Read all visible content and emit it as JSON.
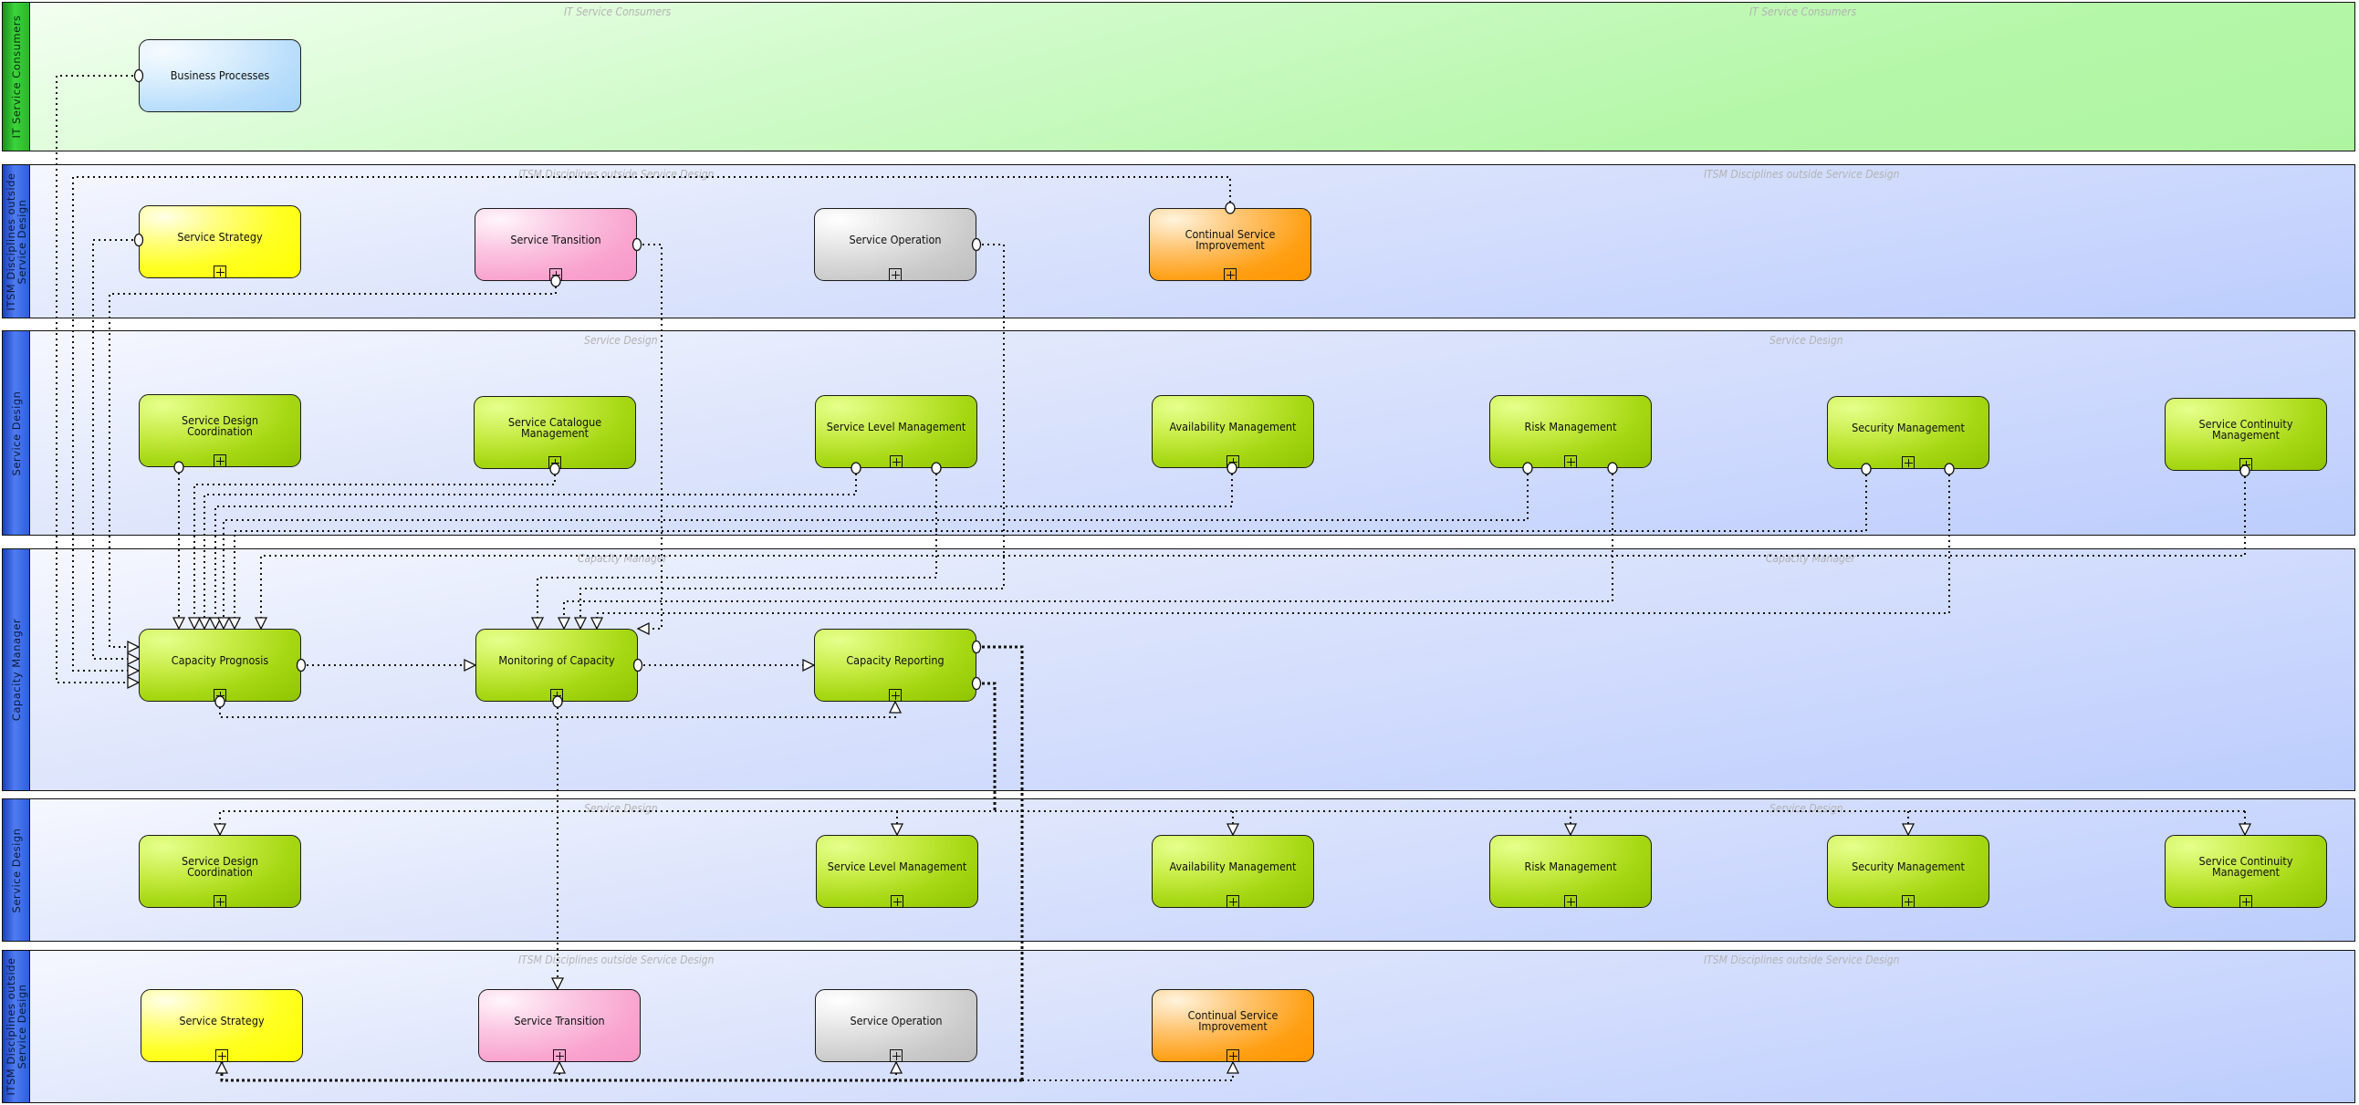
{
  "diagram": {
    "type": "process-map",
    "lanes": [
      {
        "id": "consumers",
        "title": "IT Service Consumers",
        "watermark": "IT Service Consumers",
        "color": "green"
      },
      {
        "id": "itsm-top",
        "title": "ITSM Disciplines outside\nService Design",
        "watermark": "ITSM Disciplines outside Service Design",
        "color": "blue"
      },
      {
        "id": "sd-top",
        "title": "Service Design",
        "watermark": "Service Design",
        "color": "blue"
      },
      {
        "id": "capacity",
        "title": "Capacity Manager",
        "watermark": "Capacity Manager",
        "color": "blue"
      },
      {
        "id": "sd-bottom",
        "title": "Service Design",
        "watermark": "Service Design",
        "color": "blue"
      },
      {
        "id": "itsm-bottom",
        "title": "ITSM Disciplines outside\nService Design",
        "watermark": "ITSM Disciplines outside Service Design",
        "color": "blue"
      }
    ],
    "nodes": {
      "bp": {
        "label": "Business Processes",
        "lane": "consumers",
        "color": "blue",
        "expandable": false
      },
      "ss1": {
        "label": "Service Strategy",
        "lane": "itsm-top",
        "color": "yellow",
        "expandable": true
      },
      "st1": {
        "label": "Service Transition",
        "lane": "itsm-top",
        "color": "pink",
        "expandable": true
      },
      "so1": {
        "label": "Service Operation",
        "lane": "itsm-top",
        "color": "gray",
        "expandable": true
      },
      "csi1": {
        "label": "Continual Service\nImprovement",
        "lane": "itsm-top",
        "color": "orange",
        "expandable": true
      },
      "sdc1": {
        "label": "Service Design\nCoordination",
        "lane": "sd-top",
        "color": "green",
        "expandable": true
      },
      "scm1": {
        "label": "Service Catalogue\nManagement",
        "lane": "sd-top",
        "color": "green",
        "expandable": true
      },
      "slm1": {
        "label": "Service Level Management",
        "lane": "sd-top",
        "color": "green",
        "expandable": true
      },
      "am1": {
        "label": "Availability Management",
        "lane": "sd-top",
        "color": "green",
        "expandable": true
      },
      "rm1": {
        "label": "Risk Management",
        "lane": "sd-top",
        "color": "green",
        "expandable": true
      },
      "sec1": {
        "label": "Security Management",
        "lane": "sd-top",
        "color": "green",
        "expandable": true
      },
      "scont1": {
        "label": "Service Continuity\nManagement",
        "lane": "sd-top",
        "color": "green",
        "expandable": true
      },
      "cp": {
        "label": "Capacity Prognosis",
        "lane": "capacity",
        "color": "green",
        "expandable": true
      },
      "moc": {
        "label": "Monitoring of Capacity",
        "lane": "capacity",
        "color": "green",
        "expandable": true
      },
      "cr": {
        "label": "Capacity Reporting",
        "lane": "capacity",
        "color": "green",
        "expandable": true
      },
      "sdc2": {
        "label": "Service Design\nCoordination",
        "lane": "sd-bottom",
        "color": "green",
        "expandable": true
      },
      "slm2": {
        "label": "Service Level Management",
        "lane": "sd-bottom",
        "color": "green",
        "expandable": true
      },
      "am2": {
        "label": "Availability Management",
        "lane": "sd-bottom",
        "color": "green",
        "expandable": true
      },
      "rm2": {
        "label": "Risk Management",
        "lane": "sd-bottom",
        "color": "green",
        "expandable": true
      },
      "sec2": {
        "label": "Security Management",
        "lane": "sd-bottom",
        "color": "green",
        "expandable": true
      },
      "scont2": {
        "label": "Service Continuity\nManagement",
        "lane": "sd-bottom",
        "color": "green",
        "expandable": true
      },
      "ss2": {
        "label": "Service Strategy",
        "lane": "itsm-bottom",
        "color": "yellow",
        "expandable": true
      },
      "st2": {
        "label": "Service Transition",
        "lane": "itsm-bottom",
        "color": "pink",
        "expandable": true
      },
      "so2": {
        "label": "Service Operation",
        "lane": "itsm-bottom",
        "color": "gray",
        "expandable": true
      },
      "csi2": {
        "label": "Continual Service\nImprovement",
        "lane": "itsm-bottom",
        "color": "orange",
        "expandable": true
      }
    },
    "edges": [
      {
        "from": "bp",
        "to": "cp"
      },
      {
        "from": "csi1",
        "to": "cp"
      },
      {
        "from": "ss1",
        "to": "cp"
      },
      {
        "from": "st1",
        "to": "cp"
      },
      {
        "from": "st1",
        "to": "moc"
      },
      {
        "from": "so1",
        "to": "moc"
      },
      {
        "from": "sdc1",
        "to": "cp"
      },
      {
        "from": "scm1",
        "to": "cp"
      },
      {
        "from": "slm1",
        "to": "cp"
      },
      {
        "from": "am1",
        "to": "cp"
      },
      {
        "from": "rm1",
        "to": "cp"
      },
      {
        "from": "sec1",
        "to": "cp"
      },
      {
        "from": "scont1",
        "to": "cp"
      },
      {
        "from": "slm1",
        "to": "moc"
      },
      {
        "from": "rm1",
        "to": "moc"
      },
      {
        "from": "sec1",
        "to": "moc"
      },
      {
        "from": "cp",
        "to": "moc"
      },
      {
        "from": "moc",
        "to": "cr"
      },
      {
        "from": "cp",
        "to": "cr"
      },
      {
        "from": "moc",
        "to": "st2"
      },
      {
        "from": "cr",
        "to": "sdc2"
      },
      {
        "from": "cr",
        "to": "slm2"
      },
      {
        "from": "cr",
        "to": "am2"
      },
      {
        "from": "cr",
        "to": "rm2"
      },
      {
        "from": "cr",
        "to": "sec2"
      },
      {
        "from": "cr",
        "to": "scont2"
      },
      {
        "from": "cr",
        "to": "ss2"
      },
      {
        "from": "cr",
        "to": "st2"
      },
      {
        "from": "cr",
        "to": "so2"
      },
      {
        "from": "cr",
        "to": "csi2"
      }
    ]
  }
}
